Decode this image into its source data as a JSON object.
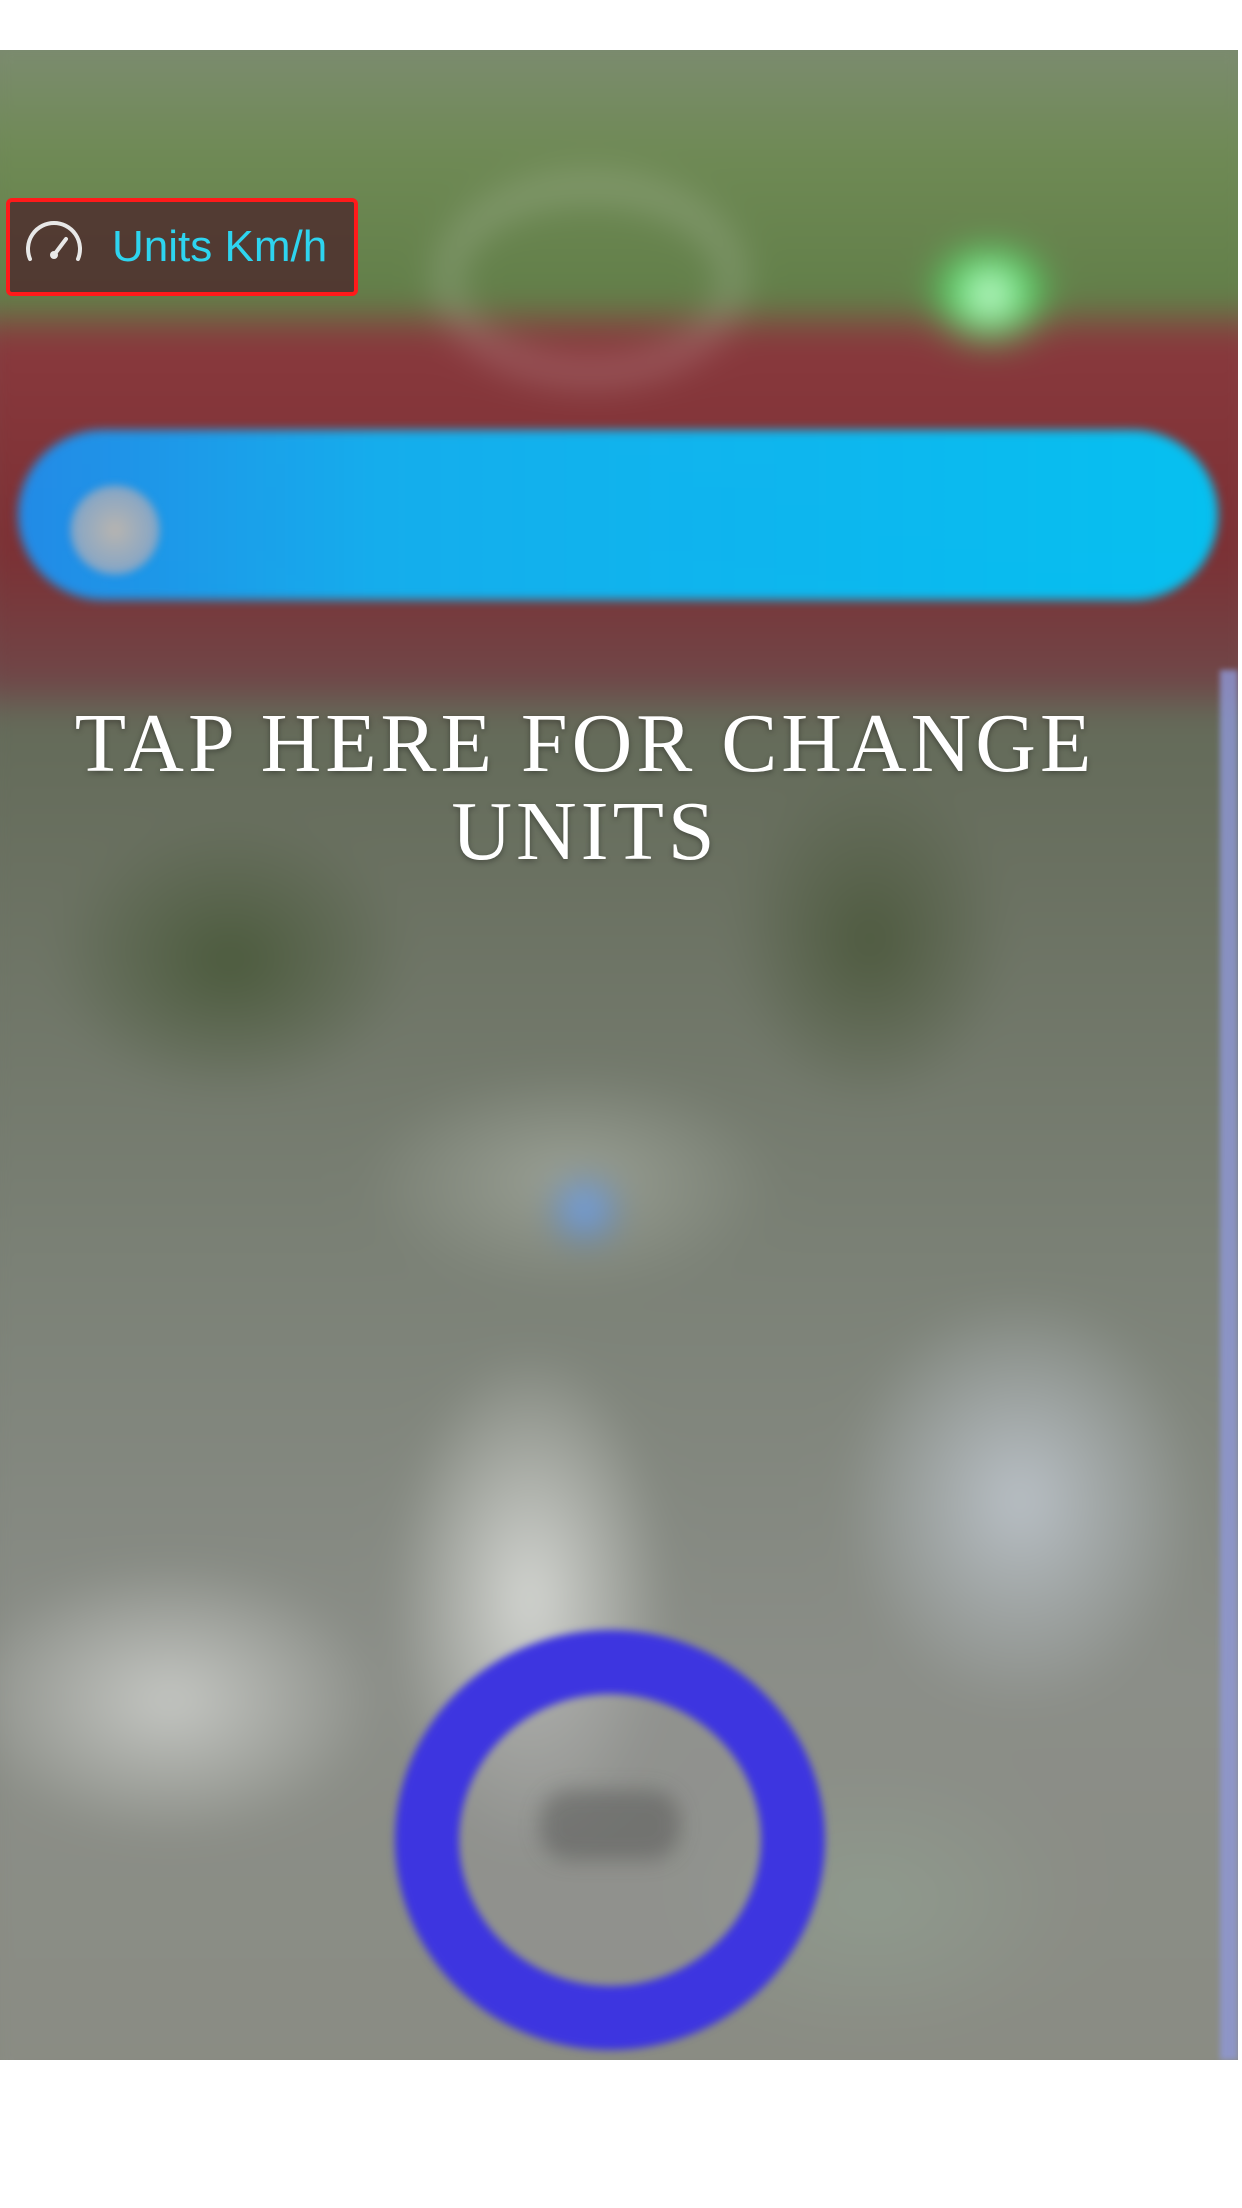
{
  "units_control": {
    "label": "Units Km/h",
    "icon": "speedometer-icon",
    "highlight_color": "#ff1a1a",
    "label_color": "#2ed4ef"
  },
  "instruction": {
    "text": "TAP HERE FOR CHANGE UNITS"
  },
  "colors": {
    "accent_bar": "#00c8fa",
    "ring": "#3d35e0"
  }
}
